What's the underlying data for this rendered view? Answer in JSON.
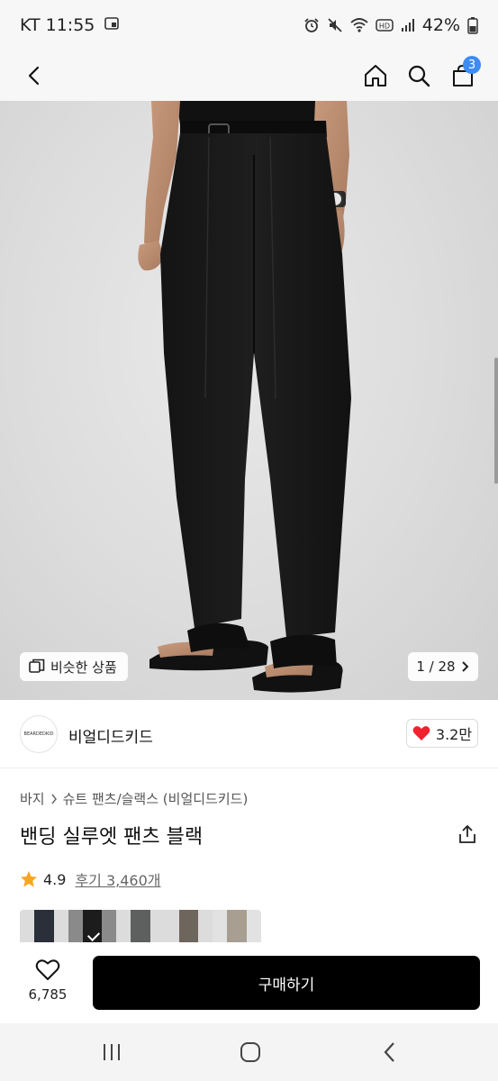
{
  "status_bar": {
    "carrier_time": "KT 11:55",
    "battery": "42%",
    "icons": [
      "sim-card-icon",
      "alarm-icon",
      "mute-icon",
      "wifi-icon",
      "hd-icon",
      "signal-icon",
      "battery-icon"
    ]
  },
  "nav": {
    "cart_count": "3",
    "icons": [
      "back-icon",
      "home-icon",
      "search-icon",
      "cart-icon"
    ]
  },
  "hero": {
    "similar_label": "비슷한 상품",
    "page_counter": "1 / 28"
  },
  "brand": {
    "logo_text": "BEARDEDKID",
    "name": "비얼디드키드",
    "like_count": "3.2만"
  },
  "product": {
    "breadcrumb": [
      "바지",
      "슈트 팬츠/슬랙스 (비얼디드키드)"
    ],
    "title": "밴딩 실루엣 팬츠 블랙",
    "rating": "4.9",
    "reviews": "후기 3,460개"
  },
  "swatches": [
    {
      "color": "#2a2f3a",
      "selected": false
    },
    {
      "color": "#1c1c1c",
      "selected": true
    },
    {
      "color": "#5e605f",
      "selected": false
    },
    {
      "color": "#6e655c",
      "selected": false
    },
    {
      "color": "#a89f92",
      "selected": false
    }
  ],
  "bottom": {
    "wish_count": "6,785",
    "buy_label": "구매하기"
  },
  "colors": {
    "accent_blue": "#3c8cf4",
    "heart_red": "#f0222f",
    "star_orange": "#f6a623",
    "buy_bg": "#000000"
  }
}
